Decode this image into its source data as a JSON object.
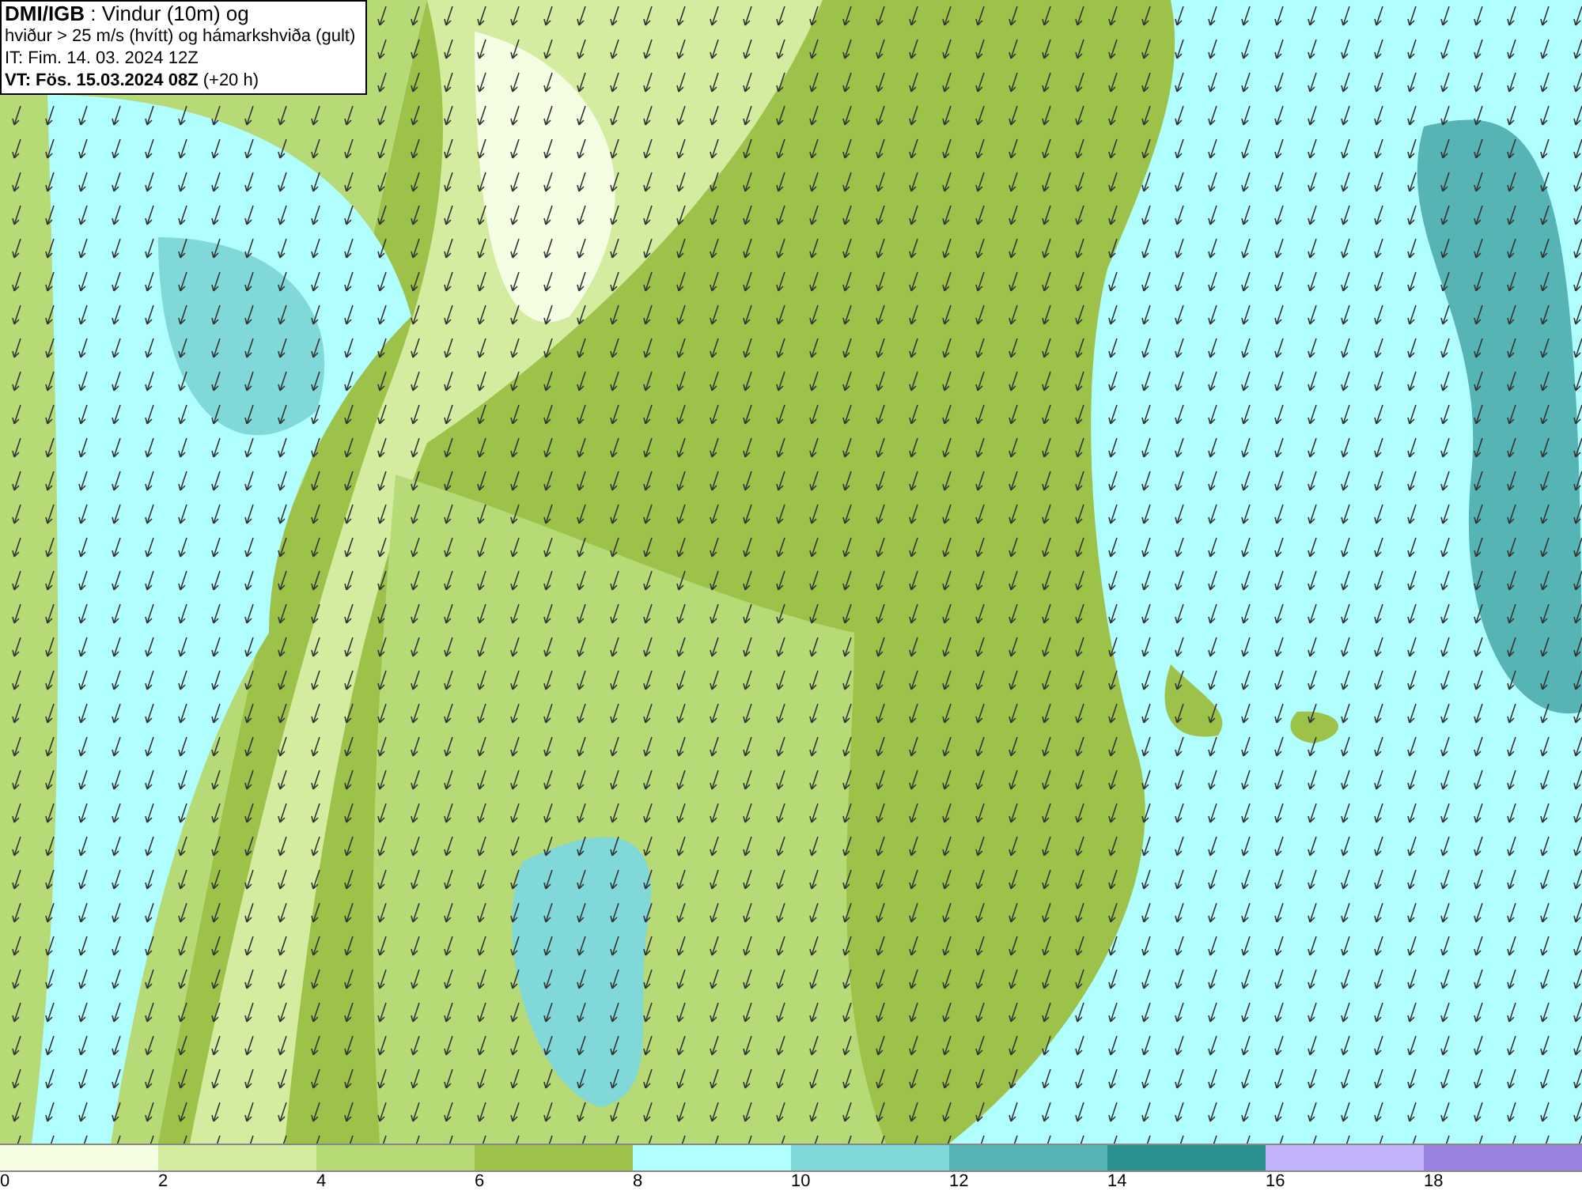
{
  "header": {
    "lines": [
      "**DMI/IGB** : Vindur (10m) og",
      "hviður > 25 m/s (hvítt) og hámarkshviða (gult)",
      "IT: Fim. 14. 03. 2024 12Z",
      "**VT: Fös. 15.03.2024 08Z** (+20 h)"
    ]
  },
  "legend": {
    "segments": [
      {
        "color": "#f5fde2"
      },
      {
        "color": "#d4eca0"
      },
      {
        "color": "#b6da76"
      },
      {
        "color": "#9cc24a"
      },
      {
        "color": "#b0fefe"
      },
      {
        "color": "#80d8d8"
      },
      {
        "color": "#56b4b4"
      },
      {
        "color": "#2a9090"
      },
      {
        "color": "#c2b2fa"
      },
      {
        "color": "#9a82e0"
      }
    ],
    "ticks": [
      "0",
      "2",
      "4",
      "6",
      "8",
      "10",
      "12",
      "14",
      "16",
      "18"
    ]
  }
}
